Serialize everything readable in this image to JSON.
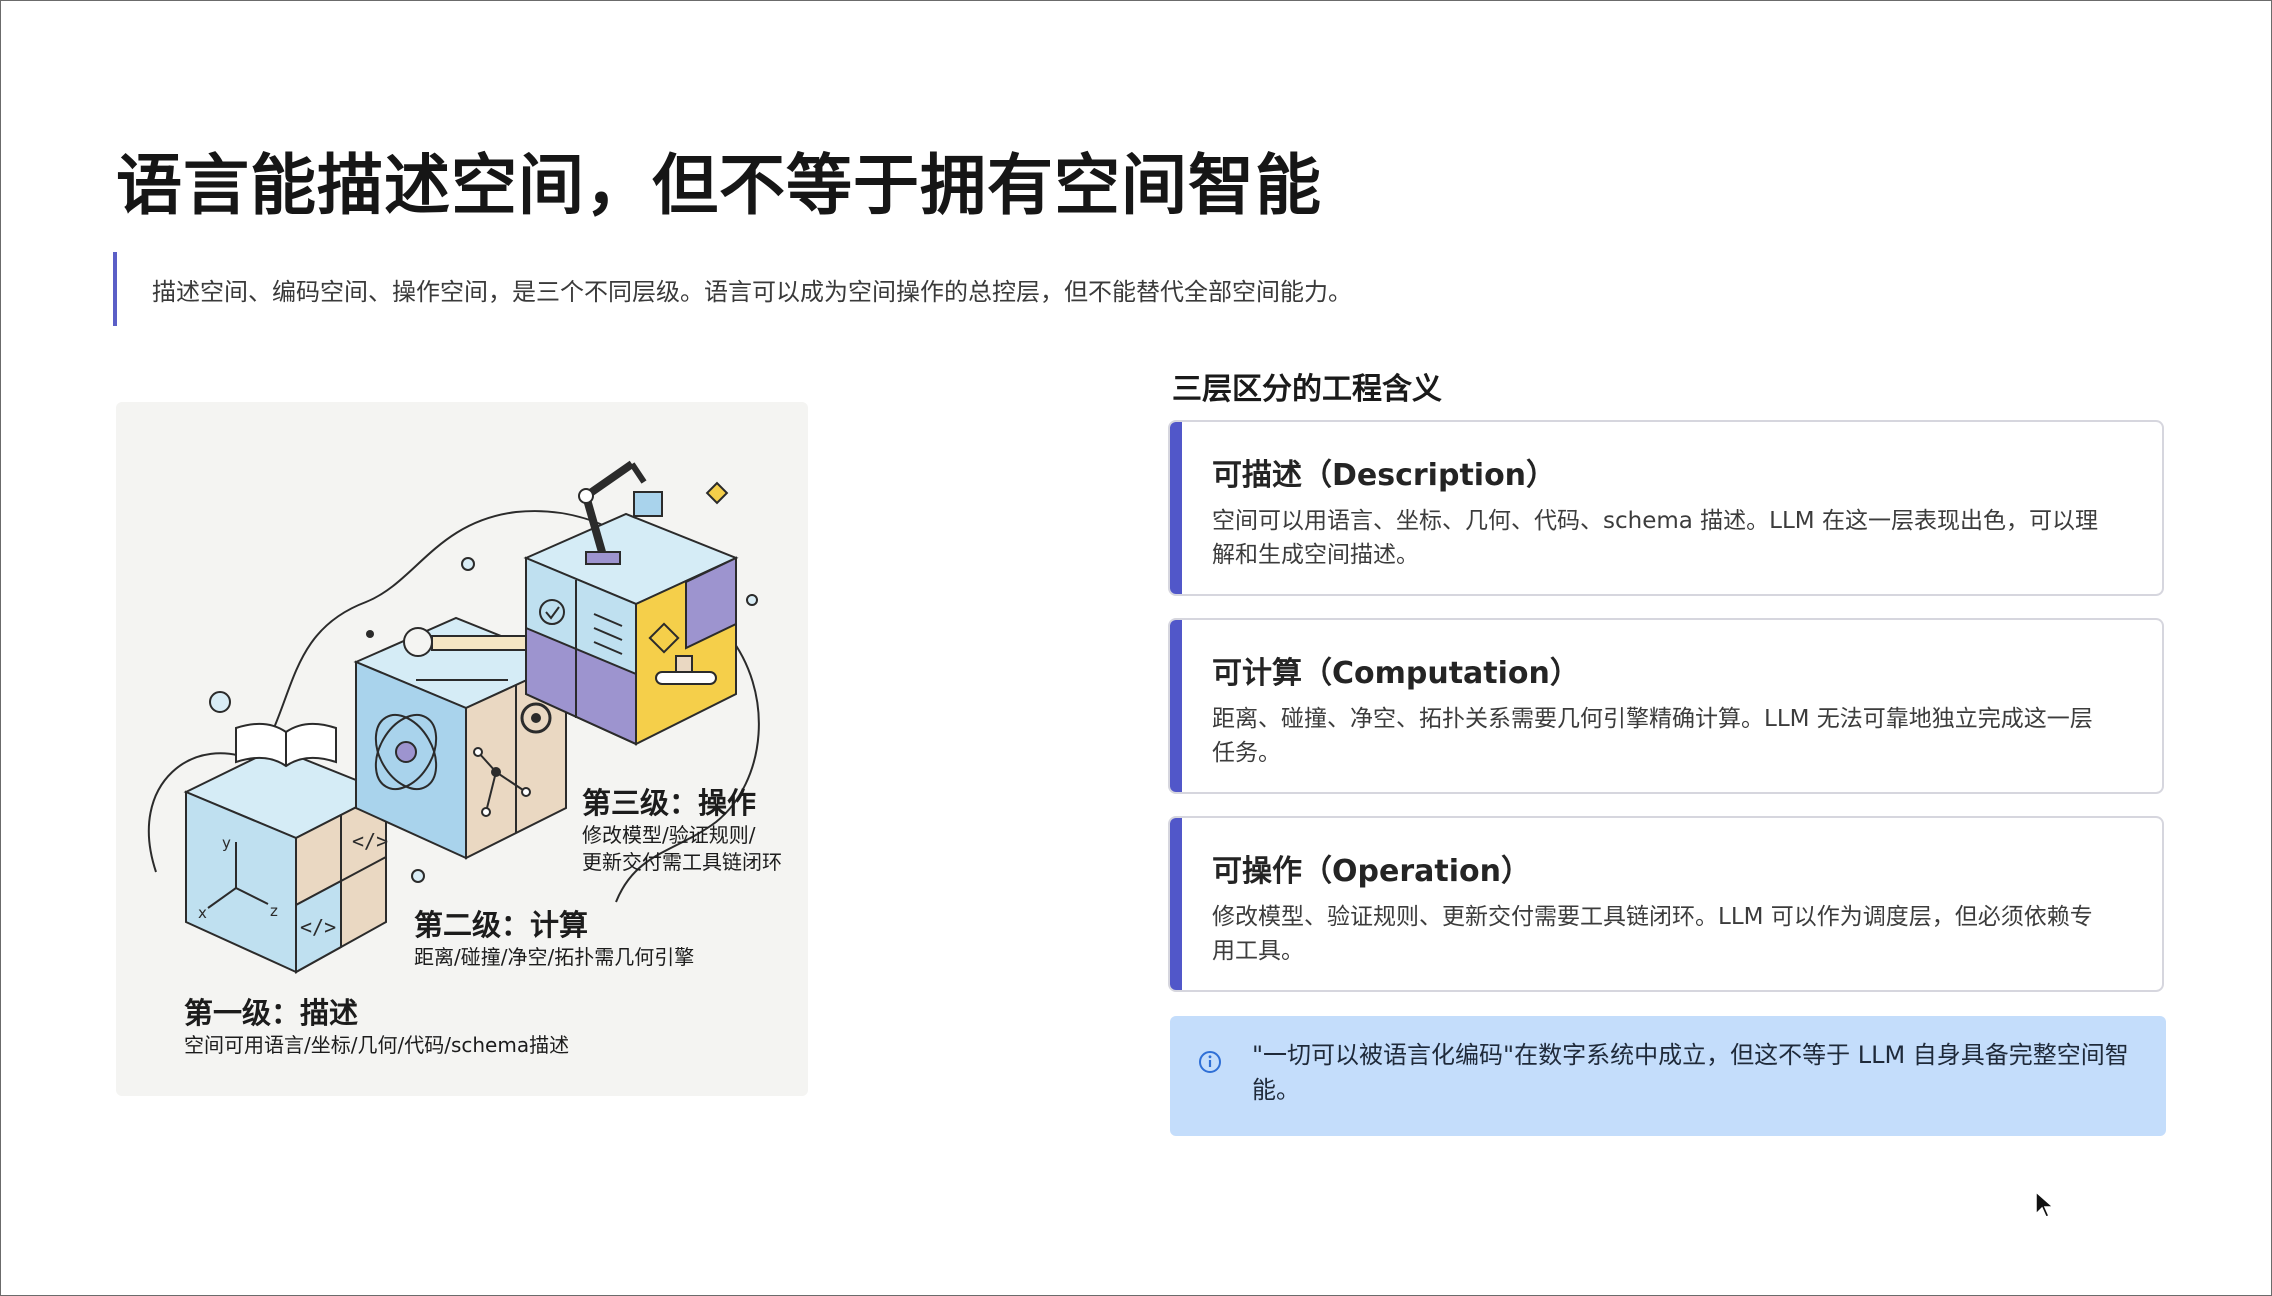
{
  "slide": {
    "title": "语言能描述空间，但不等于拥有空间智能",
    "subtitle": "描述空间、编码空间、操作空间，是三个不同层级。语言可以成为空间操作的总控层，但不能替代全部空间能力。"
  },
  "illustration": {
    "levels": [
      {
        "label": "第三级：操作",
        "desc_line1": "修改模型/验证规则/",
        "desc_line2": "更新交付需工具链闭环"
      },
      {
        "label": "第二级：计算",
        "desc_line1": "距离/碰撞/净空/拓扑需几何引擎"
      },
      {
        "label": "第一级：描述",
        "desc_line1": "空间可用语言/坐标/几何/代码/schema描述"
      }
    ],
    "axis_labels": {
      "y": "y",
      "x": "x",
      "z": "z"
    }
  },
  "panel": {
    "heading": "三层区分的工程含义",
    "cards": [
      {
        "title": "可描述（Description）",
        "body": "空间可以用语言、坐标、几何、代码、schema 描述。LLM 在这一层表现出色，可以理解和生成空间描述。"
      },
      {
        "title": "可计算（Computation）",
        "body": "距离、碰撞、净空、拓扑关系需要几何引擎精确计算。LLM 无法可靠地独立完成这一层任务。"
      },
      {
        "title": "可操作（Operation）",
        "body": "修改模型、验证规则、更新交付需要工具链闭环。LLM 可以作为调度层，但必须依赖专用工具。"
      }
    ],
    "note": {
      "icon": "info-icon",
      "text": "\"一切可以被语言化编码\"在数字系统中成立，但这不等于 LLM 自身具备完整空间智能。"
    }
  },
  "colors": {
    "accent": "#5157c9",
    "card_border": "#d6d6de",
    "note_bg": "#c4ddfb",
    "cube_blue": "#bfe0f0",
    "cube_tan": "#ead8c2",
    "cube_purple": "#9d94cf",
    "cube_yellow": "#f5cf4a"
  }
}
